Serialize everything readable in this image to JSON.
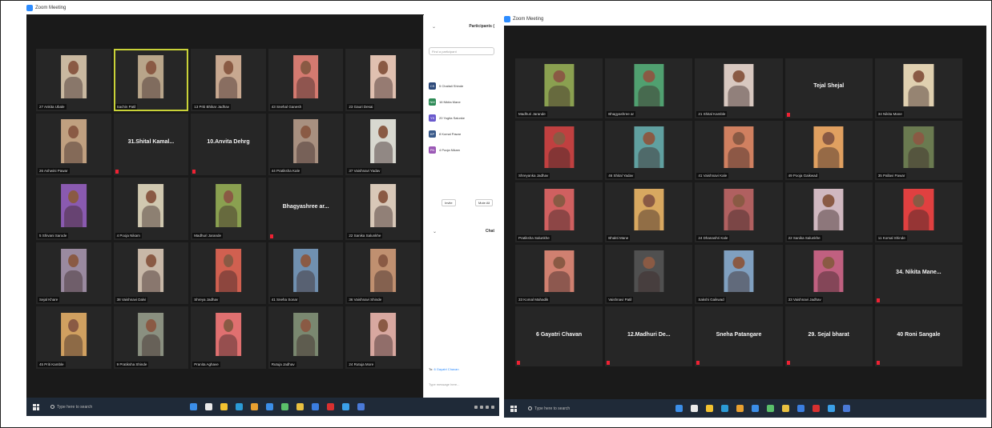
{
  "left_window": {
    "title": "Zoom Meeting",
    "tiles": [
      {
        "name": "27 Ankita Ubale",
        "kind": "video",
        "tone": "#c9b8a0"
      },
      {
        "name": "Sachin Patil",
        "kind": "video",
        "tone": "#b8a58a",
        "active": true
      },
      {
        "name": "13 Priti Bhikar Jadhav",
        "kind": "video",
        "tone": "#c8a890"
      },
      {
        "name": "43 Snehal Ganesh",
        "kind": "video",
        "tone": "#d47a70"
      },
      {
        "name": "23 Gauri Desai",
        "kind": "video",
        "tone": "#e0c0b0"
      },
      {
        "name": "26 Ashwini Pawar",
        "kind": "video",
        "tone": "#c0a080"
      },
      {
        "name": "31.Shital Kamal...",
        "kind": "name"
      },
      {
        "name": "10.Anvita Dehrg",
        "kind": "name"
      },
      {
        "name": "44 Pratiksha Kale",
        "kind": "video",
        "tone": "#a89080"
      },
      {
        "name": "37 Vaishnavi Yadav",
        "kind": "video",
        "tone": "#d8d8d0"
      },
      {
        "name": "5 Shivani Sarode",
        "kind": "video",
        "tone": "#8a5ab0"
      },
      {
        "name": "4 Pooja Nikam",
        "kind": "video",
        "tone": "#d0c8b0"
      },
      {
        "name": "Madhuri Jarande",
        "kind": "video",
        "tone": "#8aa050"
      },
      {
        "name": "Bhagyashree ar...",
        "kind": "name"
      },
      {
        "name": "22 Sanika Salunkhe",
        "kind": "video",
        "tone": "#d8c8b8"
      },
      {
        "name": "Sejal Khare",
        "kind": "video",
        "tone": "#9a8aa0"
      },
      {
        "name": "38 Vaishnavi Dalvi",
        "kind": "video",
        "tone": "#c8b8a8"
      },
      {
        "name": "Shreya Jadhav",
        "kind": "video",
        "tone": "#d06050"
      },
      {
        "name": "41 Sneha Sonar",
        "kind": "video",
        "tone": "#7090b0"
      },
      {
        "name": "36 Vaishnavi Shinde",
        "kind": "video",
        "tone": "#c09070"
      },
      {
        "name": "45 Priti Kamble",
        "kind": "video",
        "tone": "#d0a060"
      },
      {
        "name": "9 Pratiksha Shinde",
        "kind": "video",
        "tone": "#8a9080"
      },
      {
        "name": "Pranita Aghave",
        "kind": "video",
        "tone": "#e07070"
      },
      {
        "name": "Rutuja Jadhav",
        "kind": "video",
        "tone": "#7a8870"
      },
      {
        "name": "24 Rutuja More",
        "kind": "video",
        "tone": "#d8a8a0"
      }
    ],
    "panel": {
      "title": "Participants (",
      "search_placeholder": "Find a participant",
      "participants": [
        {
          "initials": "CS",
          "name": "5 Chaitali Shinde",
          "color": "#2d4a7a"
        },
        {
          "name": "16 Nikita Mane",
          "initials": "NM",
          "color": "#2e8b57"
        },
        {
          "name": "20 Yogita Salunke",
          "initials": "YS",
          "color": "#6a5acd"
        },
        {
          "name": "8 Komal Pawar",
          "initials": "KP",
          "color": "#3a5a8a"
        },
        {
          "name": "4 Pooja Nikam",
          "initials": "PN",
          "color": "#9b59b6"
        }
      ],
      "invite_label": "Invite",
      "mute_label": "Mute All",
      "chat_label": "Chat",
      "to_label": "To:",
      "to_value": "6 Gayatri Chavan",
      "message_placeholder": "Type message here..."
    },
    "taskbar": {
      "search_text": "Type here to search"
    }
  },
  "right_window": {
    "title": "Zoom Meeting",
    "tiles": [
      {
        "name": "Madhuri Jarande",
        "kind": "video",
        "tone": "#8aa050"
      },
      {
        "name": "Bhagyashree ar",
        "kind": "video",
        "tone": "#50a070"
      },
      {
        "name": "21 Shital Kamble",
        "kind": "video",
        "tone": "#d8c8c0"
      },
      {
        "name": "Tejal Shejal",
        "kind": "name"
      },
      {
        "name": "34 Nikita Mane",
        "kind": "video",
        "tone": "#e0d0b0"
      },
      {
        "name": "Shreyanka Jadhav",
        "kind": "video",
        "tone": "#c04040"
      },
      {
        "name": "46 Shital Yadav",
        "kind": "video",
        "tone": "#60a0a0"
      },
      {
        "name": "41 Vaishnavi Kale",
        "kind": "video",
        "tone": "#d08060"
      },
      {
        "name": "49 Pooja Gaikwad",
        "kind": "video",
        "tone": "#e0a060"
      },
      {
        "name": "35 Pallavi Pawar",
        "kind": "video",
        "tone": "#6a7a50"
      },
      {
        "name": "Pratiksha Salunkhe",
        "kind": "video",
        "tone": "#d06060"
      },
      {
        "name": "Bhakti Mane",
        "kind": "video",
        "tone": "#d8a860"
      },
      {
        "name": "24 Dhanashri Kale",
        "kind": "video",
        "tone": "#b06060"
      },
      {
        "name": "22 Sanika Salunkhe",
        "kind": "video",
        "tone": "#d0b8c0"
      },
      {
        "name": "11 Komal Shinde",
        "kind": "video",
        "tone": "#e04040"
      },
      {
        "name": "33 Komal Mahadik",
        "kind": "video",
        "tone": "#d08070"
      },
      {
        "name": "Vaishnavi Patil",
        "kind": "video",
        "tone": "#505050"
      },
      {
        "name": "Sakshi Gaikwad",
        "kind": "video",
        "tone": "#80a0c0"
      },
      {
        "name": "33 Vaishnavi Jadhav",
        "kind": "video",
        "tone": "#c06080"
      },
      {
        "name": "34. Nikita Mane...",
        "kind": "name"
      },
      {
        "name": "6 Gayatri Chavan",
        "kind": "name"
      },
      {
        "name": "12.Madhuri De...",
        "kind": "name"
      },
      {
        "name": "Sneha Patangare",
        "kind": "name"
      },
      {
        "name": "29. Sejal bharat",
        "kind": "name"
      },
      {
        "name": "40 Roni Sangale",
        "kind": "name"
      }
    ],
    "taskbar": {
      "search_text": "Type here to search"
    }
  },
  "taskbar_icons": [
    "#3b8ee8",
    "#eaeaea",
    "#f2c230",
    "#2b9bd6",
    "#e8a030",
    "#3b8ee8",
    "#5ac06a",
    "#e8c040",
    "#3b7ee0",
    "#d83030",
    "#3ba0e8",
    "#4a7ad8"
  ]
}
